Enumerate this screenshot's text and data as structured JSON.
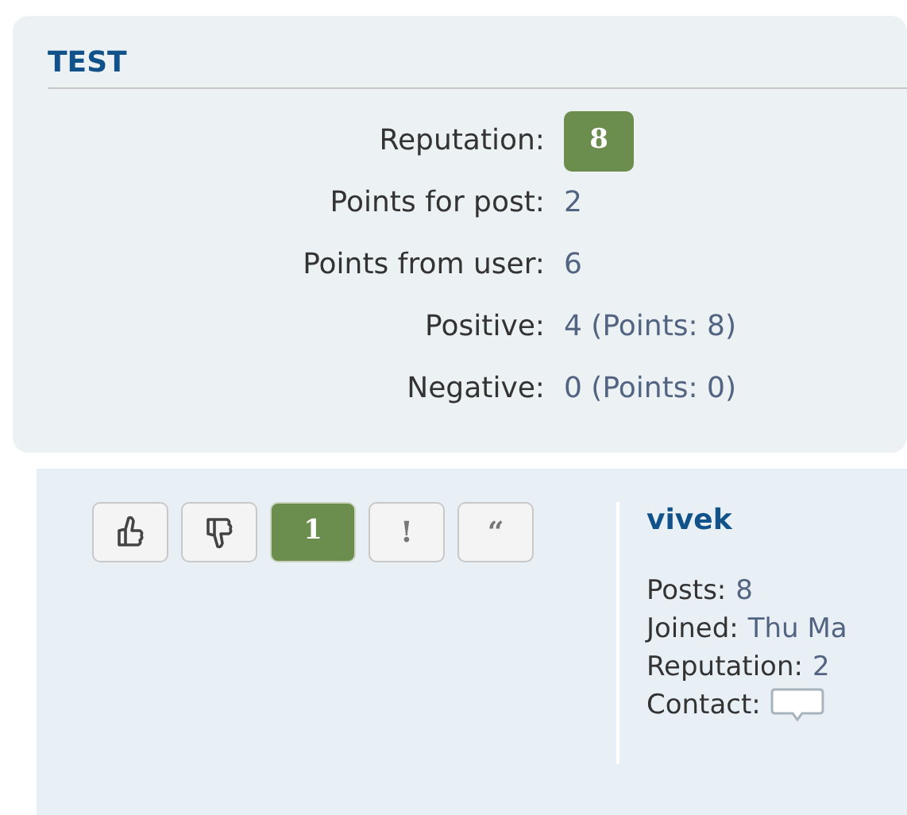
{
  "panel": {
    "title": "TEST",
    "reputation": {
      "label": "Reputation:",
      "value": "8"
    },
    "rows": [
      {
        "label": "Points for post:",
        "value": "2"
      },
      {
        "label": "Points from user:",
        "value": "6"
      },
      {
        "label": "Positive:",
        "value": "4 (Points: 8)"
      },
      {
        "label": "Negative:",
        "value": "0 (Points: 0)"
      }
    ]
  },
  "post": {
    "buttons": [
      {
        "kind": "thumbs-up"
      },
      {
        "kind": "thumbs-down"
      },
      {
        "kind": "count",
        "text": "1"
      },
      {
        "kind": "report",
        "text": "!"
      },
      {
        "kind": "quote",
        "text": "“"
      }
    ],
    "author": {
      "name": "vivek",
      "details": [
        {
          "label": "Posts:",
          "value": "8"
        },
        {
          "label": "Joined:",
          "value": "Thu Ma"
        },
        {
          "label": "Reputation:",
          "value": "2"
        }
      ],
      "contact": {
        "label": "Contact:"
      }
    }
  }
}
